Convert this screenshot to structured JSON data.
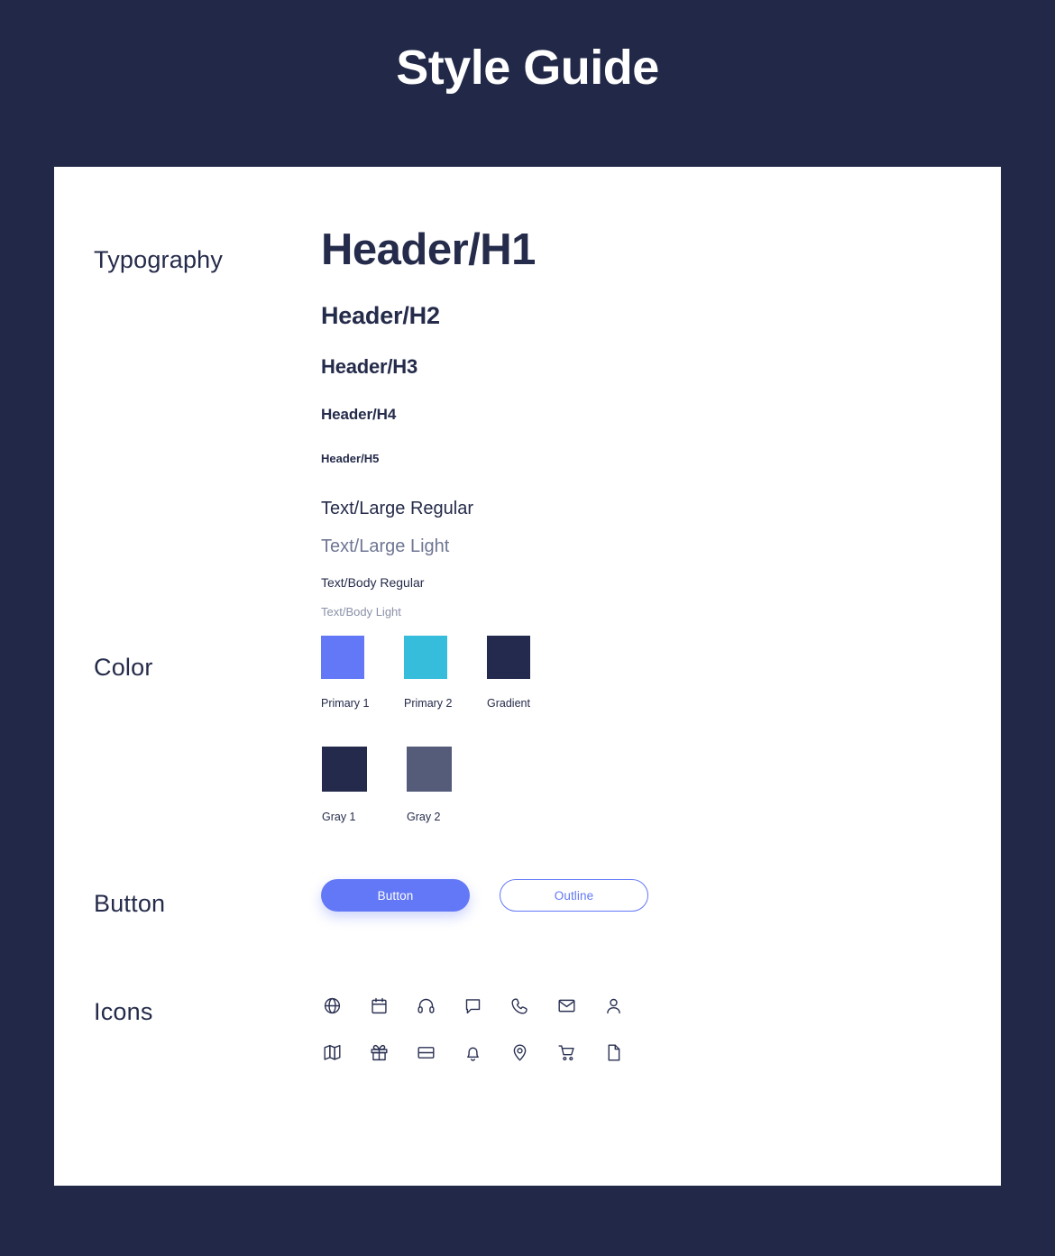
{
  "page": {
    "title": "Style Guide",
    "background_color": "#222847",
    "card_background": "#ffffff"
  },
  "sections": {
    "typography": {
      "label": "Typography",
      "samples": {
        "h1": "Header/H1",
        "h2": "Header/H2",
        "h3": "Header/H3",
        "h4": "Header/H4",
        "h5": "Header/H5",
        "large_regular": "Text/Large Regular",
        "large_light": "Text/Large Light",
        "body_regular": "Text/Body Regular",
        "body_light": "Text/Body Light"
      }
    },
    "color": {
      "label": "Color",
      "row1": [
        {
          "name": "Primary 1",
          "hex": "#6278f7"
        },
        {
          "name": "Primary 2",
          "hex": "#35bddb"
        },
        {
          "name": "Gradient",
          "hex": "#242a4e"
        }
      ],
      "row2": [
        {
          "name": "Gray 1",
          "hex": "#232a4b"
        },
        {
          "name": "Gray 2",
          "hex": "#555c79"
        }
      ]
    },
    "button": {
      "label": "Button",
      "filled_label": "Button",
      "outline_label": "Outline",
      "accent_color": "#6278f7"
    },
    "icons": {
      "label": "Icons",
      "color": "#2b3153",
      "row1": [
        "globe-icon",
        "calendar-icon",
        "headphones-icon",
        "chat-icon",
        "phone-icon",
        "envelope-icon",
        "user-icon"
      ],
      "row2": [
        "map-icon",
        "gift-icon",
        "credit-card-icon",
        "bell-icon",
        "location-pin-icon",
        "shopping-cart-icon",
        "document-icon"
      ]
    }
  }
}
